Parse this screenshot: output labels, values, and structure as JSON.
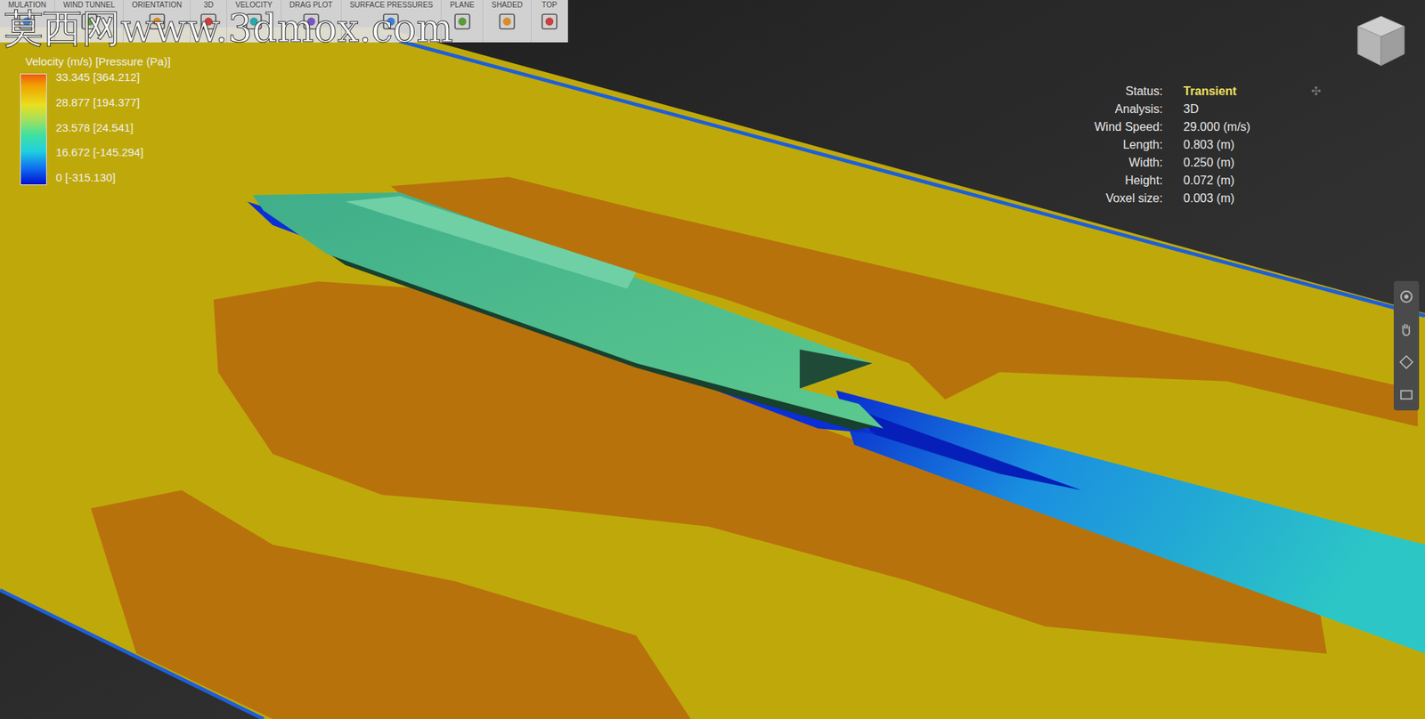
{
  "toolbar": [
    {
      "label": "MULATION"
    },
    {
      "label": "WIND TUNNEL"
    },
    {
      "label": "ORIENTATION"
    },
    {
      "label": "3D"
    },
    {
      "label": "VELOCITY"
    },
    {
      "label": "DRAG PLOT"
    },
    {
      "label": "SURFACE PRESSURES"
    },
    {
      "label": "PLANE"
    },
    {
      "label": "SHADED"
    },
    {
      "label": "TOP"
    }
  ],
  "watermark": "莫西网www.3dmox.com",
  "legend": {
    "title": "Velocity (m/s) [Pressure (Pa)]",
    "ticks": [
      "33.345 [364.212]",
      "28.877 [194.377]",
      "23.578 [24.541]",
      "16.672 [-145.294]",
      "0 [-315.130]"
    ]
  },
  "info": {
    "rows": [
      {
        "label": "Status:",
        "value": "Transient",
        "highlight": true
      },
      {
        "label": "Analysis:",
        "value": "3D",
        "highlight": false
      },
      {
        "label": "Wind Speed:",
        "value": "29.000 (m/s)",
        "highlight": false
      },
      {
        "label": "Length:",
        "value": "0.803 (m)",
        "highlight": false
      },
      {
        "label": "Width:",
        "value": "0.250 (m)",
        "highlight": false
      },
      {
        "label": "Height:",
        "value": "0.072 (m)",
        "highlight": false
      },
      {
        "label": "Voxel size:",
        "value": "0.003 (m)",
        "highlight": false
      }
    ]
  },
  "pin_glyph": "✣"
}
